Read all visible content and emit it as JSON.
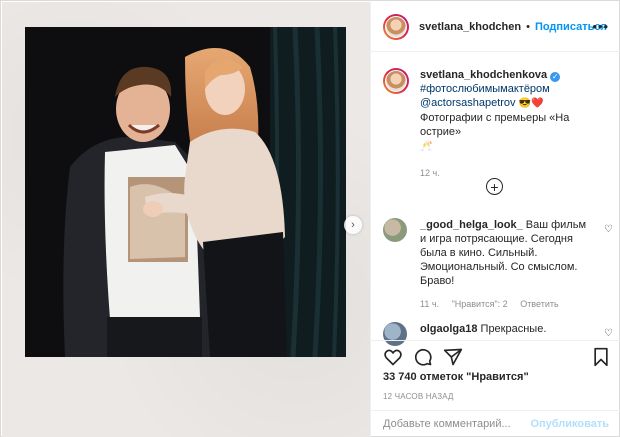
{
  "header": {
    "username": "svetlana_khodchen",
    "separator": "•",
    "follow_label": "Подписаться",
    "more_icon": "more-horizontal-icon"
  },
  "caption": {
    "username": "svetlana_khodchenkova",
    "verified_icon": "verified-badge-icon",
    "hashtag": "#фотослюбимымактёром",
    "mention": "@actorsashapetrov",
    "emojis": "😎❤️",
    "text": "Фотографии с премьеры «На острие»",
    "trailing_emoji": "🥂",
    "time": "12 ч."
  },
  "load_more_icon": "plus-circle-icon",
  "comments": [
    {
      "username": "_good_helga_look_",
      "text": "Ваш фильм и игра потрясающие. Сегодня была в кино. Сильный. Эмоциональный. Со смыслом. Браво!",
      "time": "11 ч.",
      "likes": "\"Нравится\": 2",
      "reply": "Ответить"
    },
    {
      "username": "olgaolga18",
      "text": "Прекрасные."
    }
  ],
  "actions": {
    "like_icon": "heart-icon",
    "comment_icon": "comment-icon",
    "share_icon": "paper-plane-icon",
    "save_icon": "bookmark-icon"
  },
  "likes_text": "33 740 отметок \"Нравится\"",
  "posted_ago": "12 ЧАСОВ НАЗАД",
  "add_comment": {
    "placeholder": "Добавьте комментарий...",
    "publish_label": "Опубликовать"
  },
  "media": {
    "next_icon": "chevron-right-icon"
  }
}
